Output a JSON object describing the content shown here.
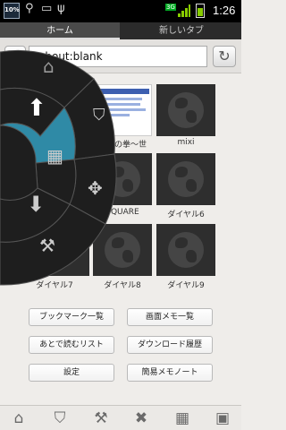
{
  "status": {
    "battery_pct": "10%",
    "network": "3G",
    "time": "1:26"
  },
  "tabs": [
    {
      "label": "ホーム"
    },
    {
      "label": "新しいタブ"
    }
  ],
  "urlbar": {
    "value": "about:blank"
  },
  "speed_dial": [
    {
      "label": ""
    },
    {
      "label": ""
    },
    {
      "label": "mixi"
    },
    {
      "label": ""
    },
    {
      "label": "SQUARE"
    },
    {
      "label": "ダイヤル6"
    },
    {
      "label": "ダイヤル7"
    },
    {
      "label": "ダイヤル8"
    },
    {
      "label": "ダイヤル9"
    }
  ],
  "page_tile_caption": "北斗の拳〜世",
  "buttons": {
    "bookmarks": "ブックマーク一覧",
    "screen_memo": "画面メモ一覧",
    "read_later": "あとで読むリスト",
    "download_history": "ダウンロード履歴",
    "settings": "設定",
    "quick_memo": "簡易メモノート"
  },
  "toolbar_icons": [
    "home-icon",
    "bookmark-icon",
    "tools-icon",
    "close-icon",
    "grid-icon",
    "screenshot-icon"
  ],
  "colors": {
    "accent_teal": "#2f8aa6",
    "radial_dark": "#1e1e1e"
  }
}
